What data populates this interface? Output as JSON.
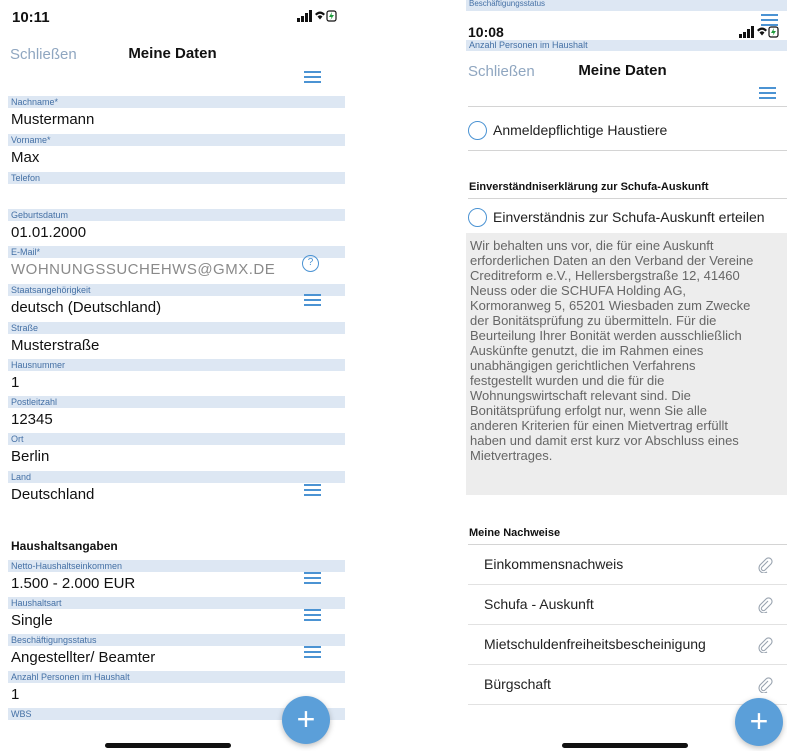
{
  "left": {
    "status_time": "10:11",
    "nav": {
      "close": "Schließen",
      "title": "Meine Daten"
    },
    "fields": [
      {
        "label": "Nachname*",
        "value": "Mustermann"
      },
      {
        "label": "Vorname*",
        "value": "Max"
      },
      {
        "label": "Telefon",
        "value": ""
      },
      {
        "label": "Geburtsdatum",
        "value": "01.01.2000"
      },
      {
        "label": "E-Mail*",
        "value": "WOHNUNGSSUCHEHWS@GMX.DE"
      },
      {
        "label": "Staatsangehörigkeit",
        "value": "deutsch (Deutschland)"
      },
      {
        "label": "Straße",
        "value": "Musterstraße"
      },
      {
        "label": "Hausnummer",
        "value": "1"
      },
      {
        "label": "Postleitzahl",
        "value": "12345"
      },
      {
        "label": "Ort",
        "value": "Berlin"
      },
      {
        "label": "Land",
        "value": "Deutschland"
      },
      {
        "label": "Netto-Haushaltseinkommen",
        "value": "1.500 - 2.000 EUR"
      },
      {
        "label": "Haushaltsart",
        "value": "Single"
      },
      {
        "label": "Beschäftigungsstatus",
        "value": "Angestellter/ Beamter"
      },
      {
        "label": "Anzahl Personen im Haushalt",
        "value": "1"
      },
      {
        "label": "WBS",
        "value": ""
      }
    ],
    "section_household": "Haushaltsangaben",
    "help_glyph": "?",
    "fab_glyph": "+"
  },
  "right": {
    "status_time": "10:08",
    "ghost_label_top": "Beschäftigungsstatus",
    "ghost_label": "Anzahl Personen im Haushalt",
    "nav": {
      "close": "Schließen",
      "title": "Meine Daten"
    },
    "pets_option": "Anmeldepflichtige Haustiere",
    "schufa_heading": "Einverständniserklärung zur Schufa-Auskunft",
    "schufa_option": "Einverständnis zur Schufa-Auskunft erteilen",
    "disclaimer_lines": [
      "Wir behalten uns vor, die für eine Auskunft",
      "erforderlichen Daten an den Verband der Vereine",
      "Creditreform e.V., Hellersbergstraße 12, 41460",
      "Neuss  oder die SCHUFA Holding AG,",
      "Kormoranweg 5, 65201 Wiesbaden zum Zwecke",
      "der Bonitätsprüfung zu übermitteln. Für die",
      "Beurteilung Ihrer Bonität werden ausschließlich",
      "Auskünfte genutzt, die im Rahmen eines",
      "unabhängigen  gerichtlichen Verfahrens",
      "festgestellt wurden und die für die",
      "Wohnungswirtschaft relevant sind. Die",
      "Bonitätsprüfung erfolgt nur, wenn Sie alle",
      "anderen Kriterien für einen Mietvertrag erfüllt",
      "haben und damit erst kurz vor Abschluss eines",
      "Mietvertrages."
    ],
    "documents_heading": "Meine Nachweise",
    "documents": [
      "Einkommensnachweis",
      "Schufa - Auskunft",
      "Mietschuldenfreiheitsbescheinigung",
      "Bürgschaft"
    ],
    "fab_glyph": "+"
  },
  "colors": {
    "accent": "#4b93d3",
    "label_bg": "#dde7f3",
    "label_text": "#4470a5",
    "nav_close": "#8fa6c0",
    "fab": "#5b9fd9",
    "disclaimer_bg": "#ededed"
  }
}
